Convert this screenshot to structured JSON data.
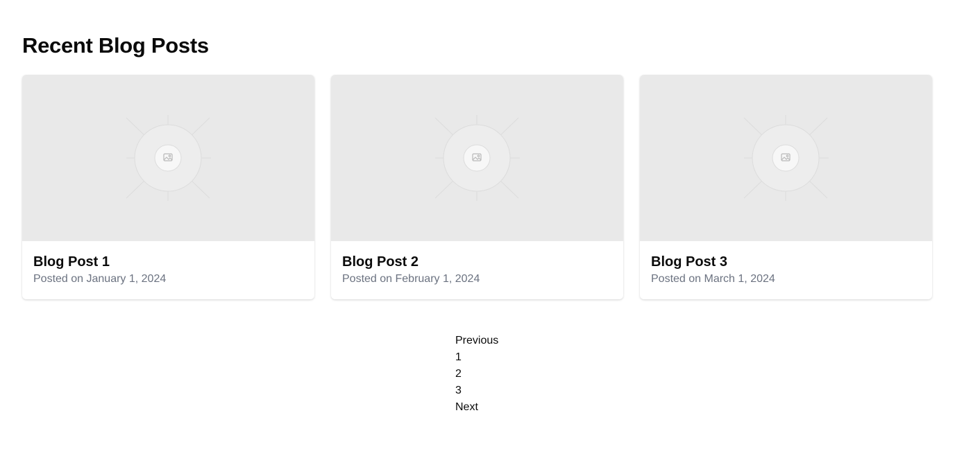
{
  "page": {
    "title": "Recent Blog Posts"
  },
  "posts": [
    {
      "title": "Blog Post 1",
      "date": "Posted on January 1, 2024",
      "image": "image-placeholder-icon"
    },
    {
      "title": "Blog Post 2",
      "date": "Posted on February 1, 2024",
      "image": "image-placeholder-icon"
    },
    {
      "title": "Blog Post 3",
      "date": "Posted on March 1, 2024",
      "image": "image-placeholder-icon"
    }
  ],
  "pagination": {
    "previous_label": "Previous",
    "pages": [
      "1",
      "2",
      "3"
    ],
    "next_label": "Next"
  },
  "colors": {
    "placeholder_bg": "#e9e9e9",
    "muted_text": "#6b7280",
    "text": "#0a0a0a"
  }
}
